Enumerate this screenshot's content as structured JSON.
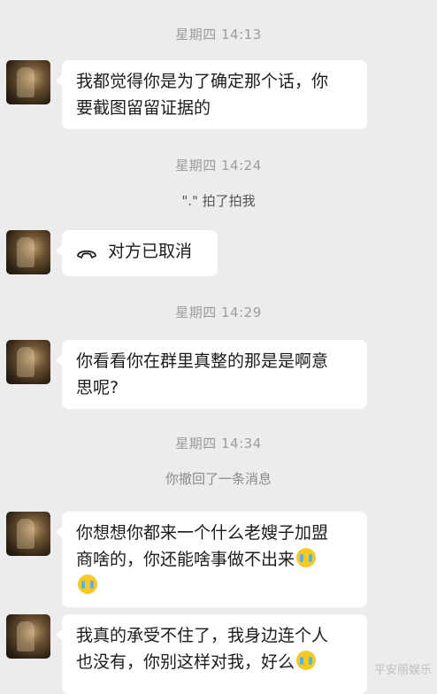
{
  "messages": [
    {
      "time": "星期四 14:13"
    },
    {
      "line1": "我都觉得你是为了确定那个话，你",
      "line2": "要截图留留证据的"
    },
    {
      "time": "星期四 14:24"
    },
    {
      "pat": "\".\" 拍了拍我"
    },
    {
      "call": "对方已取消"
    },
    {
      "time": "星期四 14:29"
    },
    {
      "line1": "你看看你在群里真整的那是是啊意",
      "line2": "思呢?"
    },
    {
      "time": "星期四 14:34"
    },
    {
      "recall": "你撤回了一条消息"
    },
    {
      "line1": "你想想你都来一个什么老嫂子加盟",
      "line2": "商啥的，你还能啥事做不出来"
    },
    {
      "line1": "我真的承受不住了，我身边连个人",
      "line2": "也没有，你别这样对我，好么"
    }
  ],
  "watermark": "平安丽娱乐",
  "emoji": "crying-face-icon"
}
